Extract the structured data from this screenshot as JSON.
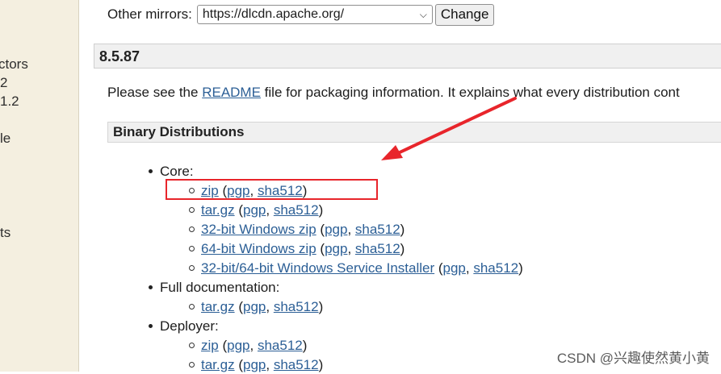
{
  "sidebar": {
    "fragments": [
      "ctors",
      "2",
      "1.2",
      "le",
      "ts"
    ]
  },
  "mirrors": {
    "label": "Other mirrors:",
    "selected": "https://dlcdn.apache.org/",
    "change_label": "Change"
  },
  "version": "8.5.87",
  "readme": {
    "prefix": "Please see the ",
    "link": "README",
    "suffix": " file for packaging information. It explains what every distribution cont"
  },
  "binary_heading": "Binary Distributions",
  "sections": [
    {
      "title": "Core:",
      "items": [
        {
          "name": "zip",
          "sig": "pgp",
          "hash": "sha512"
        },
        {
          "name": "tar.gz",
          "sig": "pgp",
          "hash": "sha512"
        },
        {
          "name": "32-bit Windows zip",
          "sig": "pgp",
          "hash": "sha512"
        },
        {
          "name": "64-bit Windows zip",
          "sig": "pgp",
          "hash": "sha512"
        },
        {
          "name": "32-bit/64-bit Windows Service Installer",
          "sig": "pgp",
          "hash": "sha512"
        }
      ]
    },
    {
      "title": "Full documentation:",
      "items": [
        {
          "name": "tar.gz",
          "sig": "pgp",
          "hash": "sha512"
        }
      ]
    },
    {
      "title": "Deployer:",
      "items": [
        {
          "name": "zip",
          "sig": "pgp",
          "hash": "sha512"
        },
        {
          "name": "tar.gz",
          "sig": "pgp",
          "hash": "sha512"
        }
      ]
    }
  ],
  "annotation": {
    "box_color": "#e8252b",
    "arrow_color": "#e8252b"
  },
  "watermark": "CSDN @兴趣使然黄小黄"
}
